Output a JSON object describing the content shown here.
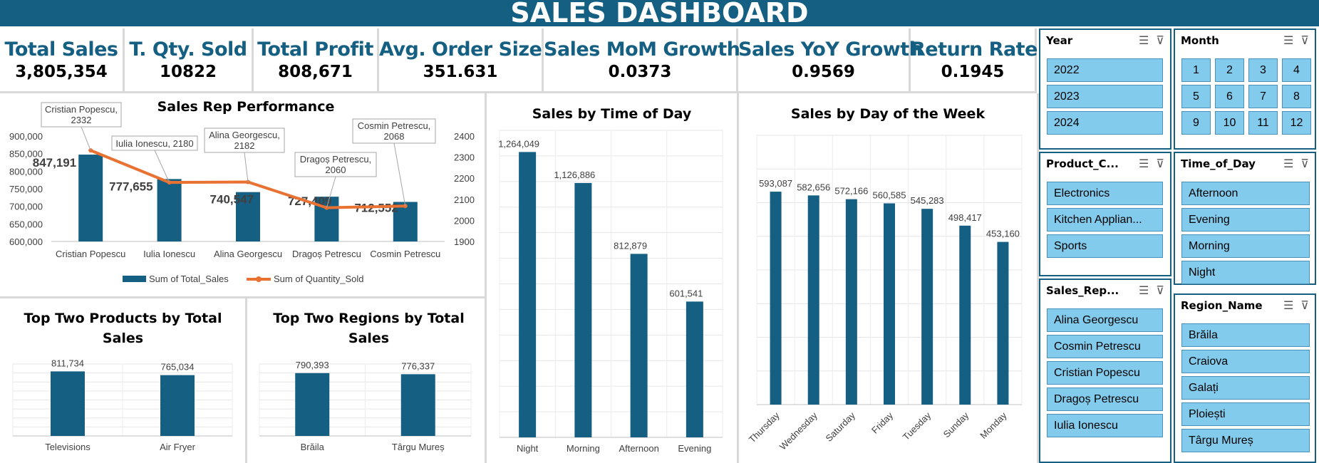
{
  "dashboard_title": "SALES DASHBOARD",
  "kpis": [
    {
      "label": "Total Sales",
      "value": "3,805,354"
    },
    {
      "label": "T. Qty. Sold",
      "value": "10822"
    },
    {
      "label": "Total Profit",
      "value": "808,671"
    },
    {
      "label": "Avg. Order Size",
      "value": "351.631"
    },
    {
      "label": "Sales MoM Growth",
      "value": "0.0373"
    },
    {
      "label": "Sales YoY Growth",
      "value": "0.9569"
    },
    {
      "label": "Return Rate",
      "value": "0.1945"
    }
  ],
  "colors": {
    "bar": "#155f82",
    "line": "#e97132",
    "slicer_button": "#82cbec",
    "banner": "#155f82",
    "accent_text": "#155f82"
  },
  "chart_data": [
    {
      "type": "bar",
      "title": "Sales Rep Performance",
      "categories": [
        "Cristian Popescu",
        "Iulia Ionescu",
        "Alina Georgescu",
        "Dragoș Petrescu",
        "Cosmin Petrescu"
      ],
      "series": [
        {
          "name": "Sum of Total_Sales",
          "values": [
            847191,
            777655,
            740547,
            727409,
            712552
          ],
          "labels": [
            "847,191",
            "777,655",
            "740,547",
            "727,409",
            "712,552"
          ],
          "axis": "primary",
          "type": "bar"
        },
        {
          "name": "Sum of Quantity_Sold",
          "values": [
            2332,
            2180,
            2182,
            2060,
            2068
          ],
          "labels": [
            "Cristian Popescu, 2332",
            "Iulia Ionescu, 2180",
            "Alina Georgescu, 2182",
            "Dragoș Petrescu, 2060",
            "Cosmin Petrescu, 2068"
          ],
          "axis": "secondary",
          "type": "line"
        }
      ],
      "ylim": [
        600000,
        900000
      ],
      "yticks": [
        "600,000",
        "650,000",
        "700,000",
        "750,000",
        "800,000",
        "850,000",
        "900,000"
      ],
      "y2lim": [
        1900,
        2400
      ],
      "y2ticks": [
        "1900",
        "2000",
        "2100",
        "2200",
        "2300",
        "2400"
      ],
      "legend": "bottom",
      "grid": false
    },
    {
      "type": "bar",
      "title": "Sales by Time of Day",
      "categories": [
        "Night",
        "Morning",
        "Afternoon",
        "Evening"
      ],
      "values": [
        1264049,
        1126886,
        812879,
        601541
      ],
      "labels": [
        "1,264,049",
        "1,126,886",
        "812,879",
        "601,541"
      ],
      "grid": true
    },
    {
      "type": "bar",
      "title": "Sales by Day of the Week",
      "categories": [
        "Thursday",
        "Wednesday",
        "Saturday",
        "Friday",
        "Tuesday",
        "Sunday",
        "Monday"
      ],
      "values": [
        593087,
        582656,
        572166,
        560585,
        545283,
        498417,
        453160
      ],
      "labels": [
        "593,087",
        "582,656",
        "572,166",
        "560,585",
        "545,283",
        "498,417",
        "453,160"
      ],
      "grid": true
    },
    {
      "type": "bar",
      "title": "Top Two Products by Total Sales",
      "categories": [
        "Televisions",
        "Air Fryer"
      ],
      "values": [
        811734,
        765034
      ],
      "labels": [
        "811,734",
        "765,034"
      ],
      "grid": true
    },
    {
      "type": "bar",
      "title": "Top Two Regions by Total Sales",
      "categories": [
        "Brăila",
        "Târgu Mureș"
      ],
      "values": [
        790393,
        776337
      ],
      "labels": [
        "790,393",
        "776,337"
      ],
      "grid": true
    }
  ],
  "slicers": {
    "year": {
      "title": "Year",
      "items": [
        "2022",
        "2023",
        "2024"
      ]
    },
    "month": {
      "title": "Month",
      "items": [
        "1",
        "2",
        "3",
        "4",
        "5",
        "6",
        "7",
        "8",
        "9",
        "10",
        "11",
        "12"
      ]
    },
    "product": {
      "title": "Product_C...",
      "items": [
        "Electronics",
        "Kitchen Applian...",
        "Sports"
      ]
    },
    "time": {
      "title": "Time_of_Day",
      "items": [
        "Afternoon",
        "Evening",
        "Morning",
        "Night"
      ]
    },
    "rep": {
      "title": "Sales_Rep...",
      "items": [
        "Alina Georgescu",
        "Cosmin Petrescu",
        "Cristian Popescu",
        "Dragoș Petrescu",
        "Iulia Ionescu"
      ]
    },
    "region": {
      "title": "Region_Name",
      "items": [
        "Brăila",
        "Craiova",
        "Galați",
        "Ploiești",
        "Târgu Mureș"
      ]
    },
    "multiselect_icon": "multi-select-icon",
    "clear_filter_icon": "clear-filter-icon"
  }
}
